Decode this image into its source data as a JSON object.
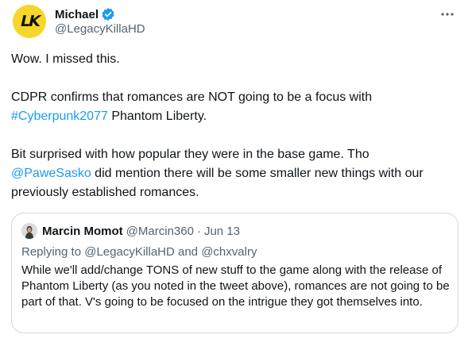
{
  "author": {
    "name": "Michael",
    "handle": "@LegacyKillaHD",
    "avatar_text": "LK",
    "verified": true,
    "avatar_color": "#f7d62b"
  },
  "menu_icon": "more-horizontal-icon",
  "tweet": {
    "para1": "Wow. I missed this.",
    "para2_before": "CDPR confirms that romances are NOT going to be a focus with",
    "para2_hashtag": "#Cyberpunk2077",
    "para2_after": " Phantom Liberty.",
    "para3_before": "Bit surprised with how popular they were in the base game. Tho",
    "para3_mention": "@PaweSasko",
    "para3_after": " did mention there will be some smaller new things with our previously established romances."
  },
  "quoted": {
    "name": "Marcin Momot",
    "handle": "@Marcin360",
    "separator": "·",
    "date": "Jun 13",
    "replying_prefix": "Replying to ",
    "replying_user1": "@LegacyKillaHD",
    "replying_and": " and ",
    "replying_user2": "@chxvalry",
    "text": "While we'll add/change TONS of new stuff to the game along with the release of Phantom Liberty (as you noted in the tweet above), romances are not going to be part of that. V's going to be focused on the intrigue they got themselves into."
  },
  "colors": {
    "link": "#1d9bf0",
    "secondary_text": "#536471",
    "primary_text": "#0f1419",
    "border": "#cfd9de"
  }
}
